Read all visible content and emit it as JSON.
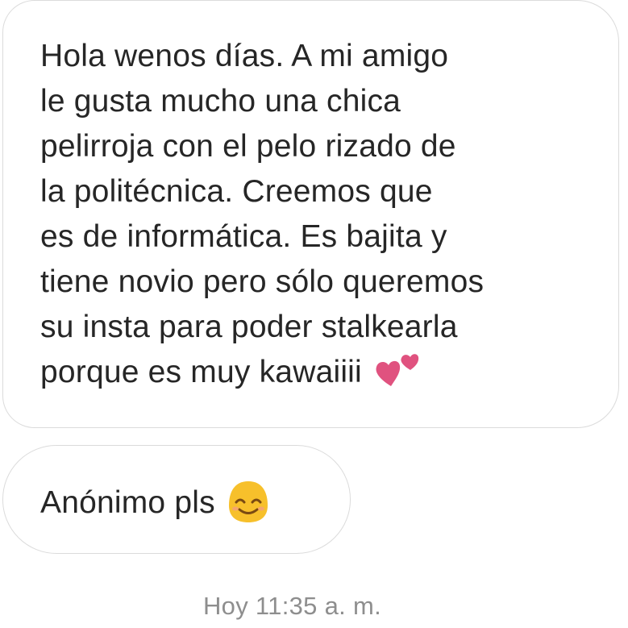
{
  "conversation": {
    "messages": [
      {
        "lines": [
          "Hola wenos días. A mi amigo",
          "le gusta mucho una chica",
          "pelirroja con el pelo rizado de",
          "la politécnica. Creemos que",
          "es de informática. Es bajita y",
          "tiene novio pero sólo queremos",
          "su insta para poder stalkearla",
          "porque es muy kawaiiii"
        ],
        "trailing_emoji": "two-hearts-icon"
      },
      {
        "text": "Anónimo pls",
        "trailing_emoji": "smiling-face-icon"
      }
    ],
    "timestamp": "Hoy 11:35 a. m."
  },
  "colors": {
    "bubble_border": "#dbdbdb",
    "text": "#262626",
    "timestamp": "#8e8e8e",
    "heart_pink": "#e0527f",
    "emoji_yellow": "#f7c02b"
  }
}
